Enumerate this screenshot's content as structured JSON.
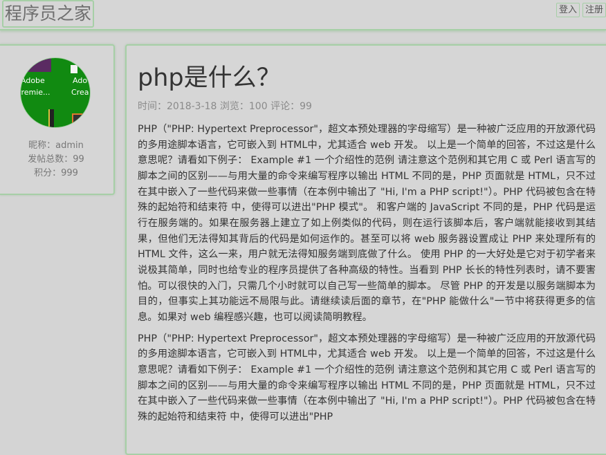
{
  "header": {
    "logo": "程序员之家",
    "login": "登入",
    "register": "注册"
  },
  "profile": {
    "avatar_labels": [
      "Adobe",
      "Premie...",
      "Ado",
      "Crea"
    ],
    "nickname": "昵称：admin",
    "posts": "发帖总数：99",
    "points": "积分：999"
  },
  "article": {
    "title": "php是什么？",
    "meta": "时间：2018-3-18  浏览：100   评论：99",
    "paragraphs": [
      "PHP（\"PHP: Hypertext Preprocessor\"，超文本预处理器的字母缩写）是一种被广泛应用的开放源代码的多用途脚本语言，它可嵌入到 HTML中，尤其适合 web 开发。 以上是一个简单的回答，不过这是什么意思呢？请看如下例子： Example #1 一个介绍性的范例 请注意这个范例和其它用 C 或 Perl 语言写的脚本之间的区别——与用大量的命令来编写程序以输出 HTML 不同的是，PHP 页面就是 HTML，只不过在其中嵌入了一些代码来做一些事情（在本例中输出了 \"Hi, I'm a PHP script!\"）。PHP 代码被包含在特殊的起始符和结束符 中，使得可以进出\"PHP 模式\"。 和客户端的 JavaScript 不同的是，PHP 代码是运行在服务端的。如果在服务器上建立了如上例类似的代码，则在运行该脚本后，客户端就能接收到其结果，但他们无法得知其背后的代码是如何运作的。甚至可以将 web 服务器设置成让 PHP 来处理所有的 HTML 文件，这么一来，用户就无法得知服务端到底做了什么。 使用 PHP 的一大好处是它对于初学者来说极其简单，同时也给专业的程序员提供了各种高级的特性。当看到 PHP 长长的特性列表时，请不要害怕。可以很快的入门，只需几个小时就可以自己写一些简单的脚本。 尽管 PHP 的开发是以服务端脚本为目的，但事实上其功能远不局限与此。请继续读后面的章节，在\"PHP 能做什么\"一节中将获得更多的信息。如果对 web 编程感兴趣，也可以阅读简明教程。",
      "PHP（\"PHP: Hypertext Preprocessor\"，超文本预处理器的字母缩写）是一种被广泛应用的开放源代码的多用途脚本语言，它可嵌入到 HTML中，尤其适合 web 开发。 以上是一个简单的回答，不过这是什么意思呢？请看如下例子： Example #1 一个介绍性的范例 请注意这个范例和其它用 C 或 Perl 语言写的脚本之间的区别——与用大量的命令来编写程序以输出 HTML 不同的是，PHP 页面就是 HTML，只不过在其中嵌入了一些代码来做一些事情（在本例中输出了 \"Hi, I'm a PHP script!\"）。PHP 代码被包含在特殊的起始符和结束符 中，使得可以进出\"PHP"
    ]
  }
}
